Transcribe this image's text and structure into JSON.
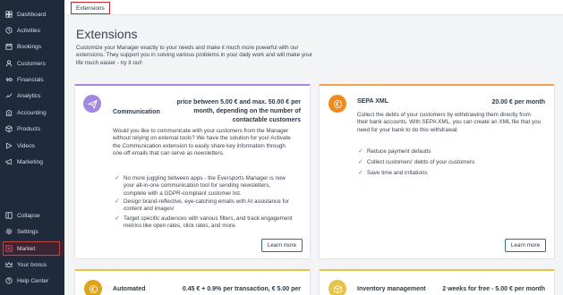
{
  "sidebar": {
    "items": [
      {
        "label": "Dashboard",
        "icon": "dashboard-icon"
      },
      {
        "label": "Activities",
        "icon": "activities-icon"
      },
      {
        "label": "Bookings",
        "icon": "bookings-icon"
      },
      {
        "label": "Customers",
        "icon": "customers-icon"
      },
      {
        "label": "Financials",
        "icon": "financials-icon"
      },
      {
        "label": "Analytics",
        "icon": "analytics-icon"
      },
      {
        "label": "Accounting",
        "icon": "accounting-icon"
      },
      {
        "label": "Products",
        "icon": "products-icon"
      },
      {
        "label": "Videos",
        "icon": "videos-icon"
      },
      {
        "label": "Marketing",
        "icon": "marketing-icon"
      }
    ],
    "bottom_items": [
      {
        "label": "Collapse",
        "icon": "collapse-icon"
      },
      {
        "label": "Settings",
        "icon": "settings-icon"
      },
      {
        "label": "Market",
        "icon": "market-icon",
        "active": true
      },
      {
        "label": "Your bonus",
        "icon": "bonus-icon"
      },
      {
        "label": "Help Center",
        "icon": "help-icon"
      }
    ]
  },
  "topbar": {
    "tab_label": "Extensions"
  },
  "page": {
    "title": "Extensions",
    "description": "Customize your Manager exactly to your needs and make it much more powerful with our extensions. They support you in solving various problems in your daily work and will make your life much easier - try it out!"
  },
  "cards": {
    "communication": {
      "title": "Communication",
      "price_lines": [
        "price between 5.00 € and max. 50.00 € per",
        "month, depending on the number of",
        "contactable customers"
      ],
      "description_lines": [
        "Would you like to communicate with your customers from the Manager",
        "without relying on external tools? We have the solution for you! Activate",
        "the Communication extension to easily share key information through",
        "one-off emails that can serve as newsletters."
      ],
      "features": [
        [
          "No more juggling between apps - the Eversports Manager is now",
          "your all-in-one communication tool for sending newsletters,",
          "complete with a GDPR-compliant customer list."
        ],
        [
          "Design brand-reflective, eye-catching emails with AI assistance for",
          "content and images!"
        ],
        [
          "Target specific audiences with various filters, and track engagement",
          "metrics like open rates, click rates, and more."
        ]
      ],
      "button": "Learn more",
      "accent": "#a487e0"
    },
    "sepa": {
      "title": "SEPA XML",
      "price": "20.00 € per month",
      "description_lines": [
        "Collect the debts of your customers by withdrawing them directly from",
        "their bank accounts. With SEPA XML, you can create an XML file that you",
        "need for your bank to do this withdrawal."
      ],
      "features": [
        "Reduce payment defaults",
        "Collect customers' debts of your customers",
        "Save time and irritations"
      ],
      "button": "Learn more",
      "accent": "#f3a14a"
    },
    "automated": {
      "title": "Automated",
      "price": "0.45 € + 0.9% per transaction, € 5.00 per"
    },
    "inventory": {
      "title": "Inventory management",
      "price": "2 weeks for free - 5.00 € per month"
    }
  },
  "colors": {
    "sidebar_bg": "#1f2a3d",
    "active_tab": "#c8242b",
    "check": "#3a9a4a",
    "button_border": "#2e6e80"
  }
}
